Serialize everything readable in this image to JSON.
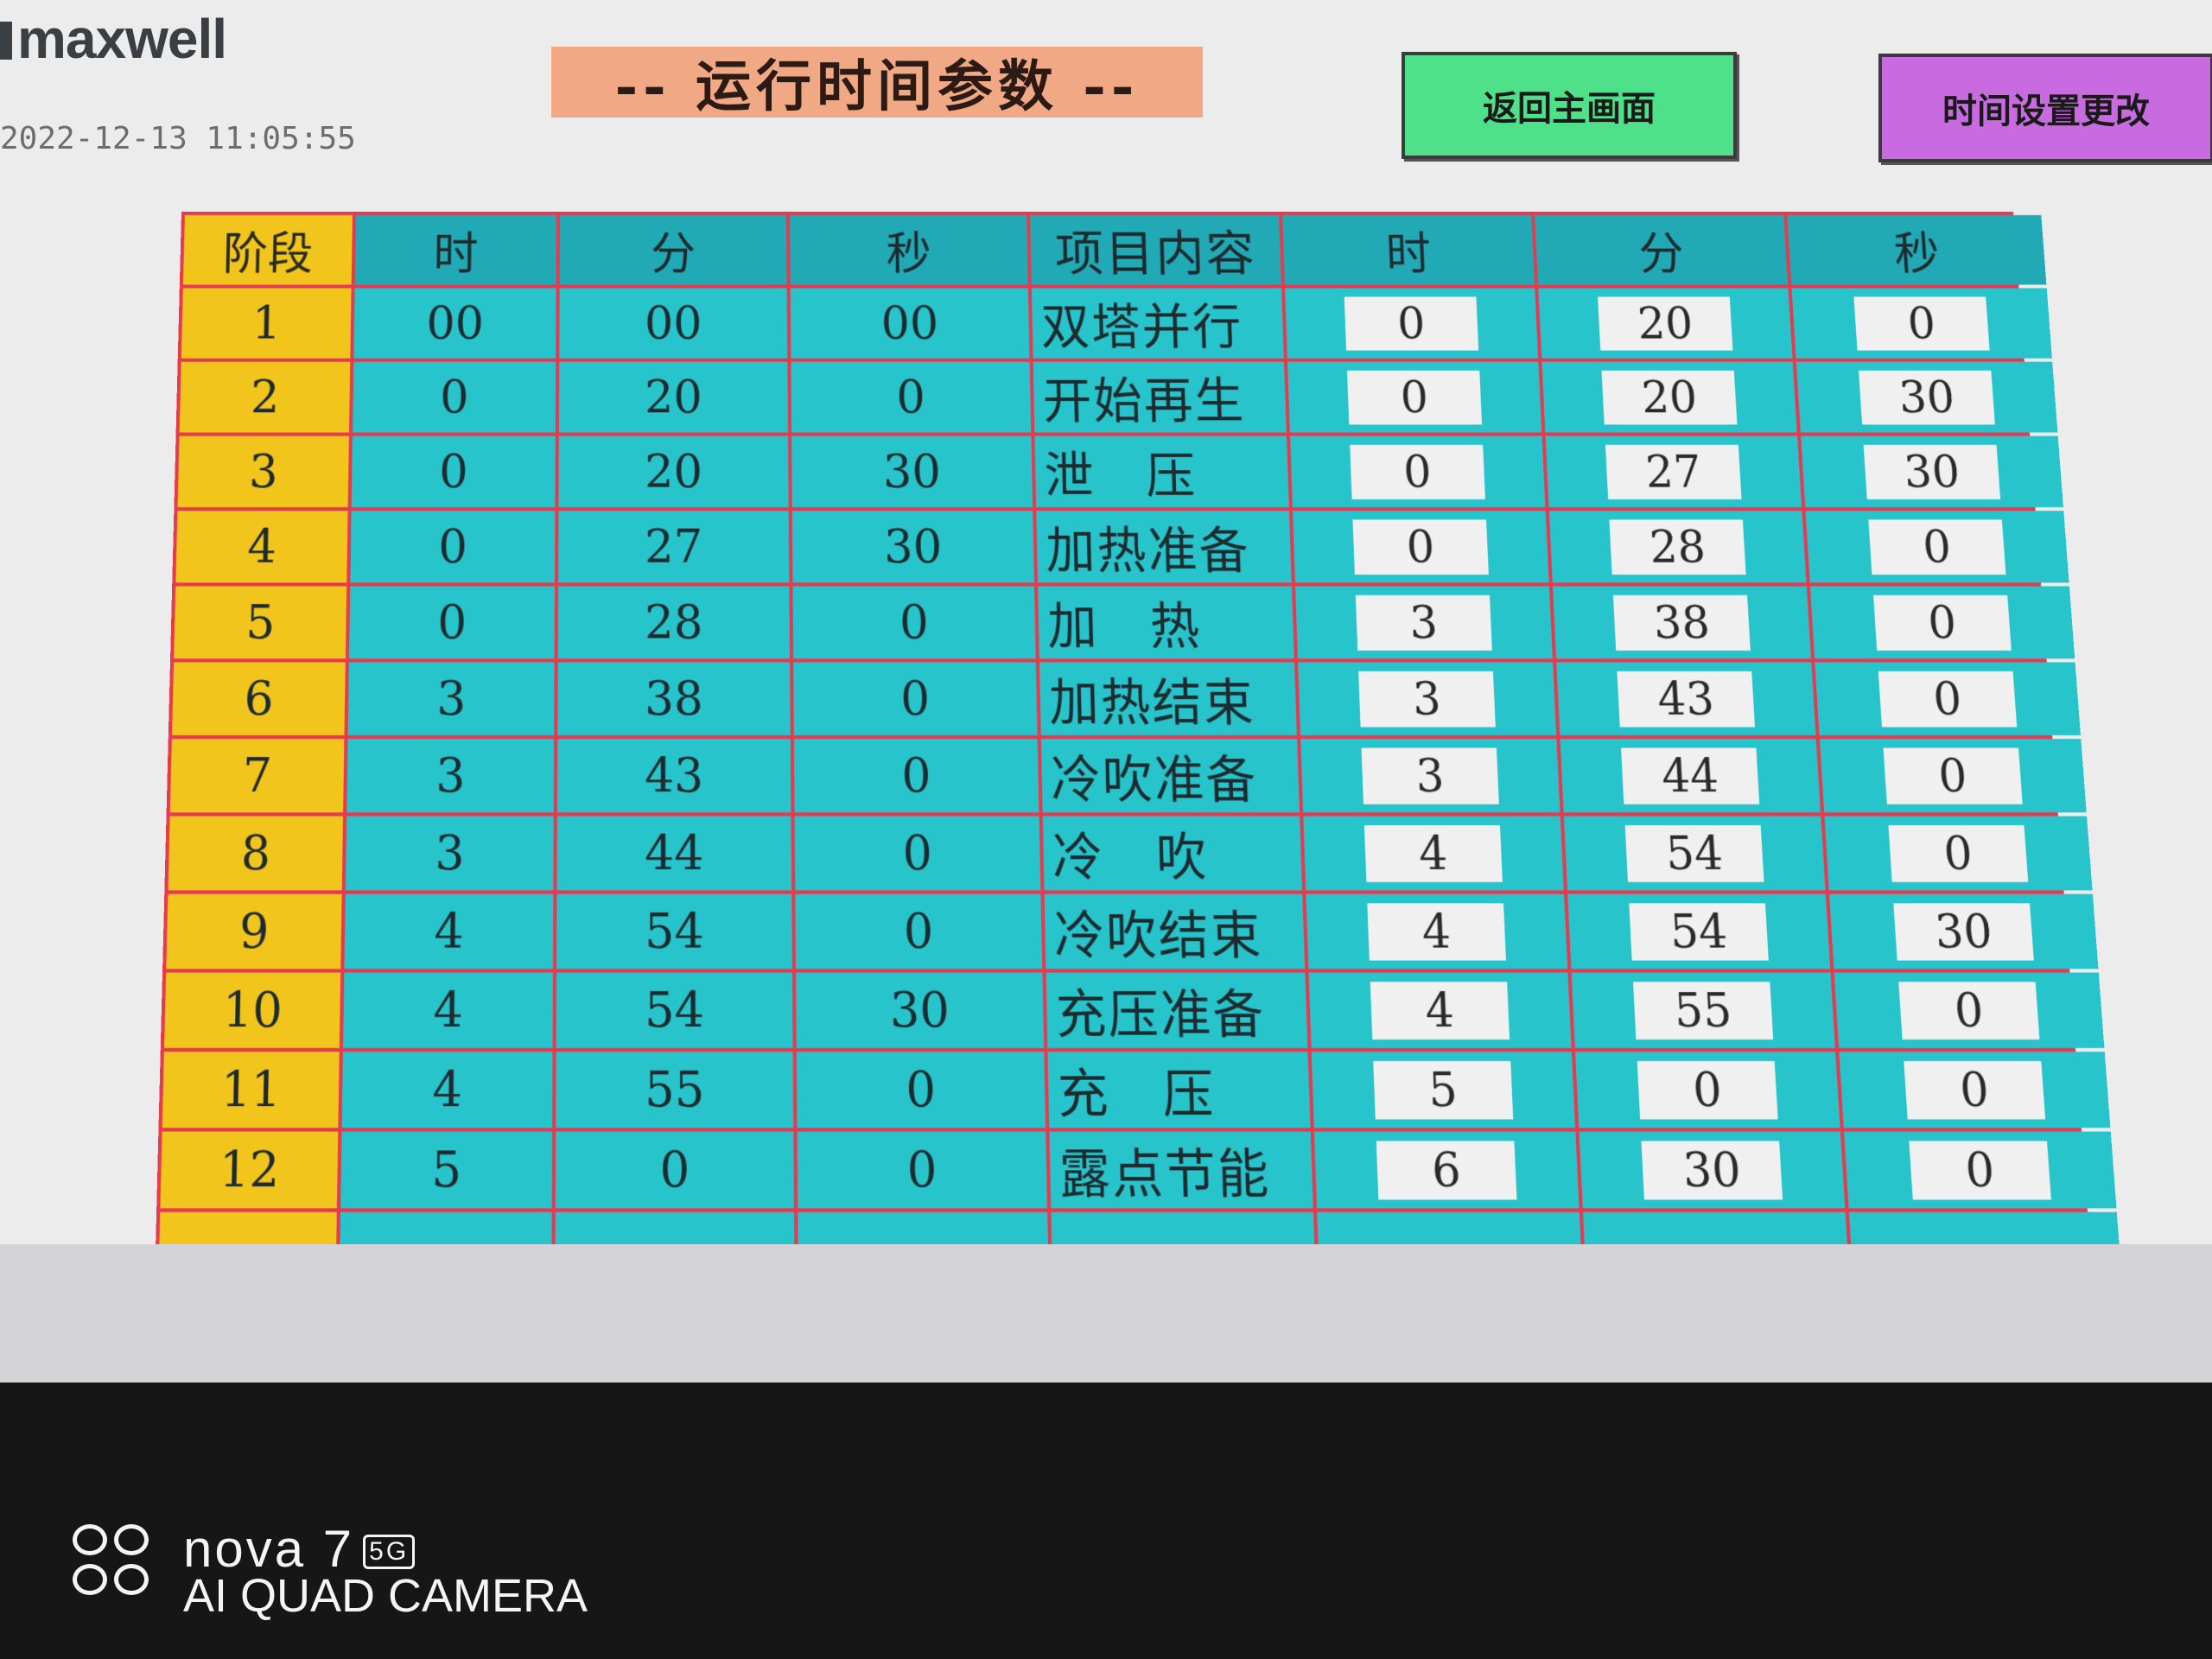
{
  "app": {
    "logo": "maxwell",
    "datetime": "2022-12-13 11:05:55",
    "title": "-- 运行时间参数 --"
  },
  "buttons": {
    "home": "返回主画面",
    "time_settings": "时间设置更改"
  },
  "table": {
    "headers": [
      "阶段",
      "时",
      "分",
      "秒",
      "项目内容",
      "时",
      "分",
      "秒"
    ],
    "rows": [
      {
        "stage": "1",
        "h": "00",
        "m": "00",
        "s": "00",
        "item": "双塔并行",
        "sh": "0",
        "sm": "20",
        "ss": "0"
      },
      {
        "stage": "2",
        "h": "0",
        "m": "20",
        "s": "0",
        "item": "开始再生",
        "sh": "0",
        "sm": "20",
        "ss": "30"
      },
      {
        "stage": "3",
        "h": "0",
        "m": "20",
        "s": "30",
        "item": "泄　压",
        "sh": "0",
        "sm": "27",
        "ss": "30"
      },
      {
        "stage": "4",
        "h": "0",
        "m": "27",
        "s": "30",
        "item": "加热准备",
        "sh": "0",
        "sm": "28",
        "ss": "0"
      },
      {
        "stage": "5",
        "h": "0",
        "m": "28",
        "s": "0",
        "item": "加　热",
        "sh": "3",
        "sm": "38",
        "ss": "0"
      },
      {
        "stage": "6",
        "h": "3",
        "m": "38",
        "s": "0",
        "item": "加热结束",
        "sh": "3",
        "sm": "43",
        "ss": "0"
      },
      {
        "stage": "7",
        "h": "3",
        "m": "43",
        "s": "0",
        "item": "冷吹准备",
        "sh": "3",
        "sm": "44",
        "ss": "0"
      },
      {
        "stage": "8",
        "h": "3",
        "m": "44",
        "s": "0",
        "item": "冷　吹",
        "sh": "4",
        "sm": "54",
        "ss": "0"
      },
      {
        "stage": "9",
        "h": "4",
        "m": "54",
        "s": "0",
        "item": "冷吹结束",
        "sh": "4",
        "sm": "54",
        "ss": "30"
      },
      {
        "stage": "10",
        "h": "4",
        "m": "54",
        "s": "30",
        "item": "充压准备",
        "sh": "4",
        "sm": "55",
        "ss": "0"
      },
      {
        "stage": "11",
        "h": "4",
        "m": "55",
        "s": "0",
        "item": "充　压",
        "sh": "5",
        "sm": "0",
        "ss": "0"
      },
      {
        "stage": "12",
        "h": "5",
        "m": "0",
        "s": "0",
        "item": "露点节能",
        "sh": "6",
        "sm": "30",
        "ss": "0"
      },
      {
        "stage": "",
        "h": "",
        "m": "",
        "s": "",
        "item": "",
        "sh": null,
        "sm": null,
        "ss": null
      },
      {
        "stage": "",
        "h": "",
        "m": "",
        "s": "",
        "item": "",
        "sh": null,
        "sm": null,
        "ss": null
      }
    ]
  },
  "watermark": {
    "line1": "nova 7",
    "badge": "5G",
    "line2": "AI QUAD CAMERA"
  },
  "colors": {
    "grid_line": "#e53a4f",
    "cell_teal": "#27c4cc",
    "stage_yellow": "#f2c51c",
    "title_bg": "#f1a884",
    "home_btn": "#4fe08a",
    "time_btn": "#c96be0"
  }
}
